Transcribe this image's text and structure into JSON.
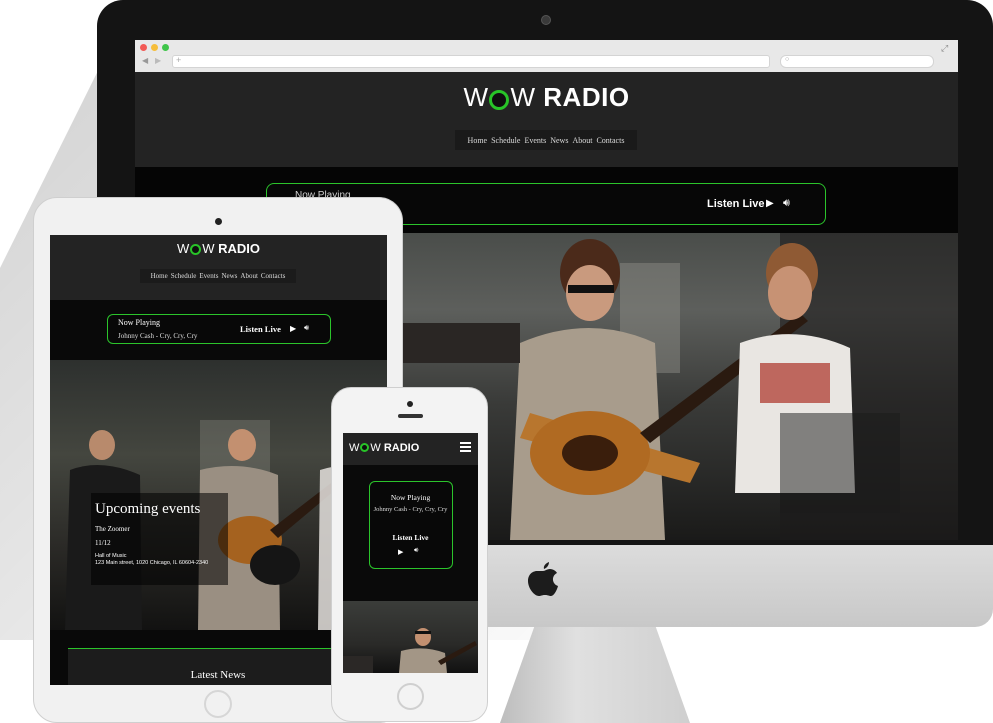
{
  "brand": {
    "logo_w": "W",
    "logo_w2": "W",
    "logo_radio": "RADIO",
    "accent_color": "#2bc42b"
  },
  "desktop": {
    "menu": [
      "Home",
      "Schedule",
      "Events",
      "News",
      "About",
      "Contacts"
    ],
    "now_playing": "Now Playing",
    "listen_live": "Listen Live"
  },
  "tablet": {
    "menu": [
      "Home",
      "Schedule",
      "Events",
      "News",
      "About",
      "Contacts"
    ],
    "now_playing": "Now Playing",
    "song": "Johnny Cash - Cry, Cry, Cry",
    "listen_live": "Listen Live",
    "events": {
      "title": "Upcoming events",
      "name": "The Zoomer",
      "date": "11/12",
      "venue": "Hall of Music",
      "address": "123 Main street, 1020 Chicago, IL 60604-2340"
    },
    "latest_news": "Latest News"
  },
  "phone": {
    "now_playing": "Now Playing",
    "song": "Johnny Cash - Cry, Cry, Cry",
    "listen_live": "Listen Live"
  },
  "icons": {
    "play": "play-icon",
    "volume": "volume-icon",
    "menu": "hamburger-icon",
    "apple": "apple-logo-icon"
  }
}
